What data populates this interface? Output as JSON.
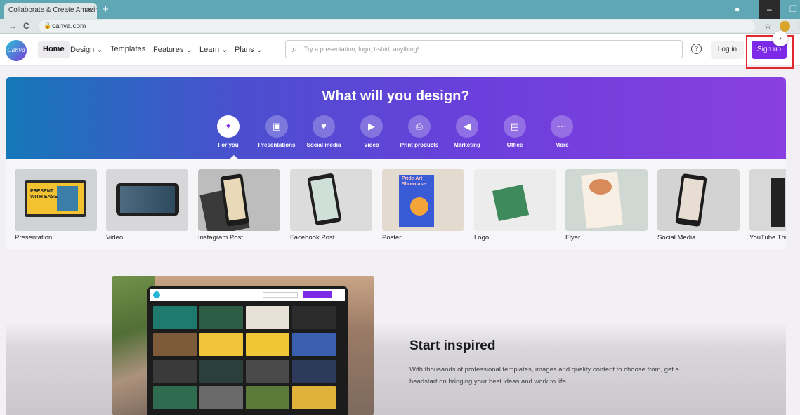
{
  "browser": {
    "tab_title": "Collaborate & Create Amazing G",
    "tab_close": "×",
    "new_tab": "+",
    "url": "canva.com"
  },
  "header": {
    "logo_text": "Canva",
    "nav": {
      "home": "Home",
      "design": "Design ⌄",
      "templates": "Templates",
      "features": "Features ⌄",
      "learn": "Learn ⌄",
      "plans": "Plans ⌄"
    },
    "search_placeholder": "Try a presentation, logo, t-shirt, anything!",
    "login": "Log in",
    "signup": "Sign up"
  },
  "hero": {
    "title": "What will you design?",
    "categories": [
      {
        "label": "For you",
        "icon": "sparkle-icon"
      },
      {
        "label": "Presentations",
        "icon": "presentation-icon"
      },
      {
        "label": "Social media",
        "icon": "heart-icon"
      },
      {
        "label": "Video",
        "icon": "video-icon"
      },
      {
        "label": "Print products",
        "icon": "printer-icon"
      },
      {
        "label": "Marketing",
        "icon": "megaphone-icon"
      },
      {
        "label": "Office",
        "icon": "briefcase-icon"
      },
      {
        "label": "More",
        "icon": "more-icon"
      }
    ]
  },
  "design_types": [
    {
      "label": "Presentation"
    },
    {
      "label": "Video"
    },
    {
      "label": "Instagram Post"
    },
    {
      "label": "Facebook Post"
    },
    {
      "label": "Poster"
    },
    {
      "label": "Logo"
    },
    {
      "label": "Flyer"
    },
    {
      "label": "Social Media"
    },
    {
      "label": "YouTube Thu"
    }
  ],
  "inspired": {
    "title": "Start inspired",
    "text": "With thousands of professional templates, images and quality content to choose from, get a headstart on bringing your best ideas and work to life."
  },
  "colors": {
    "accent": "#7d2ae8",
    "highlight_box": "#e0282e"
  }
}
